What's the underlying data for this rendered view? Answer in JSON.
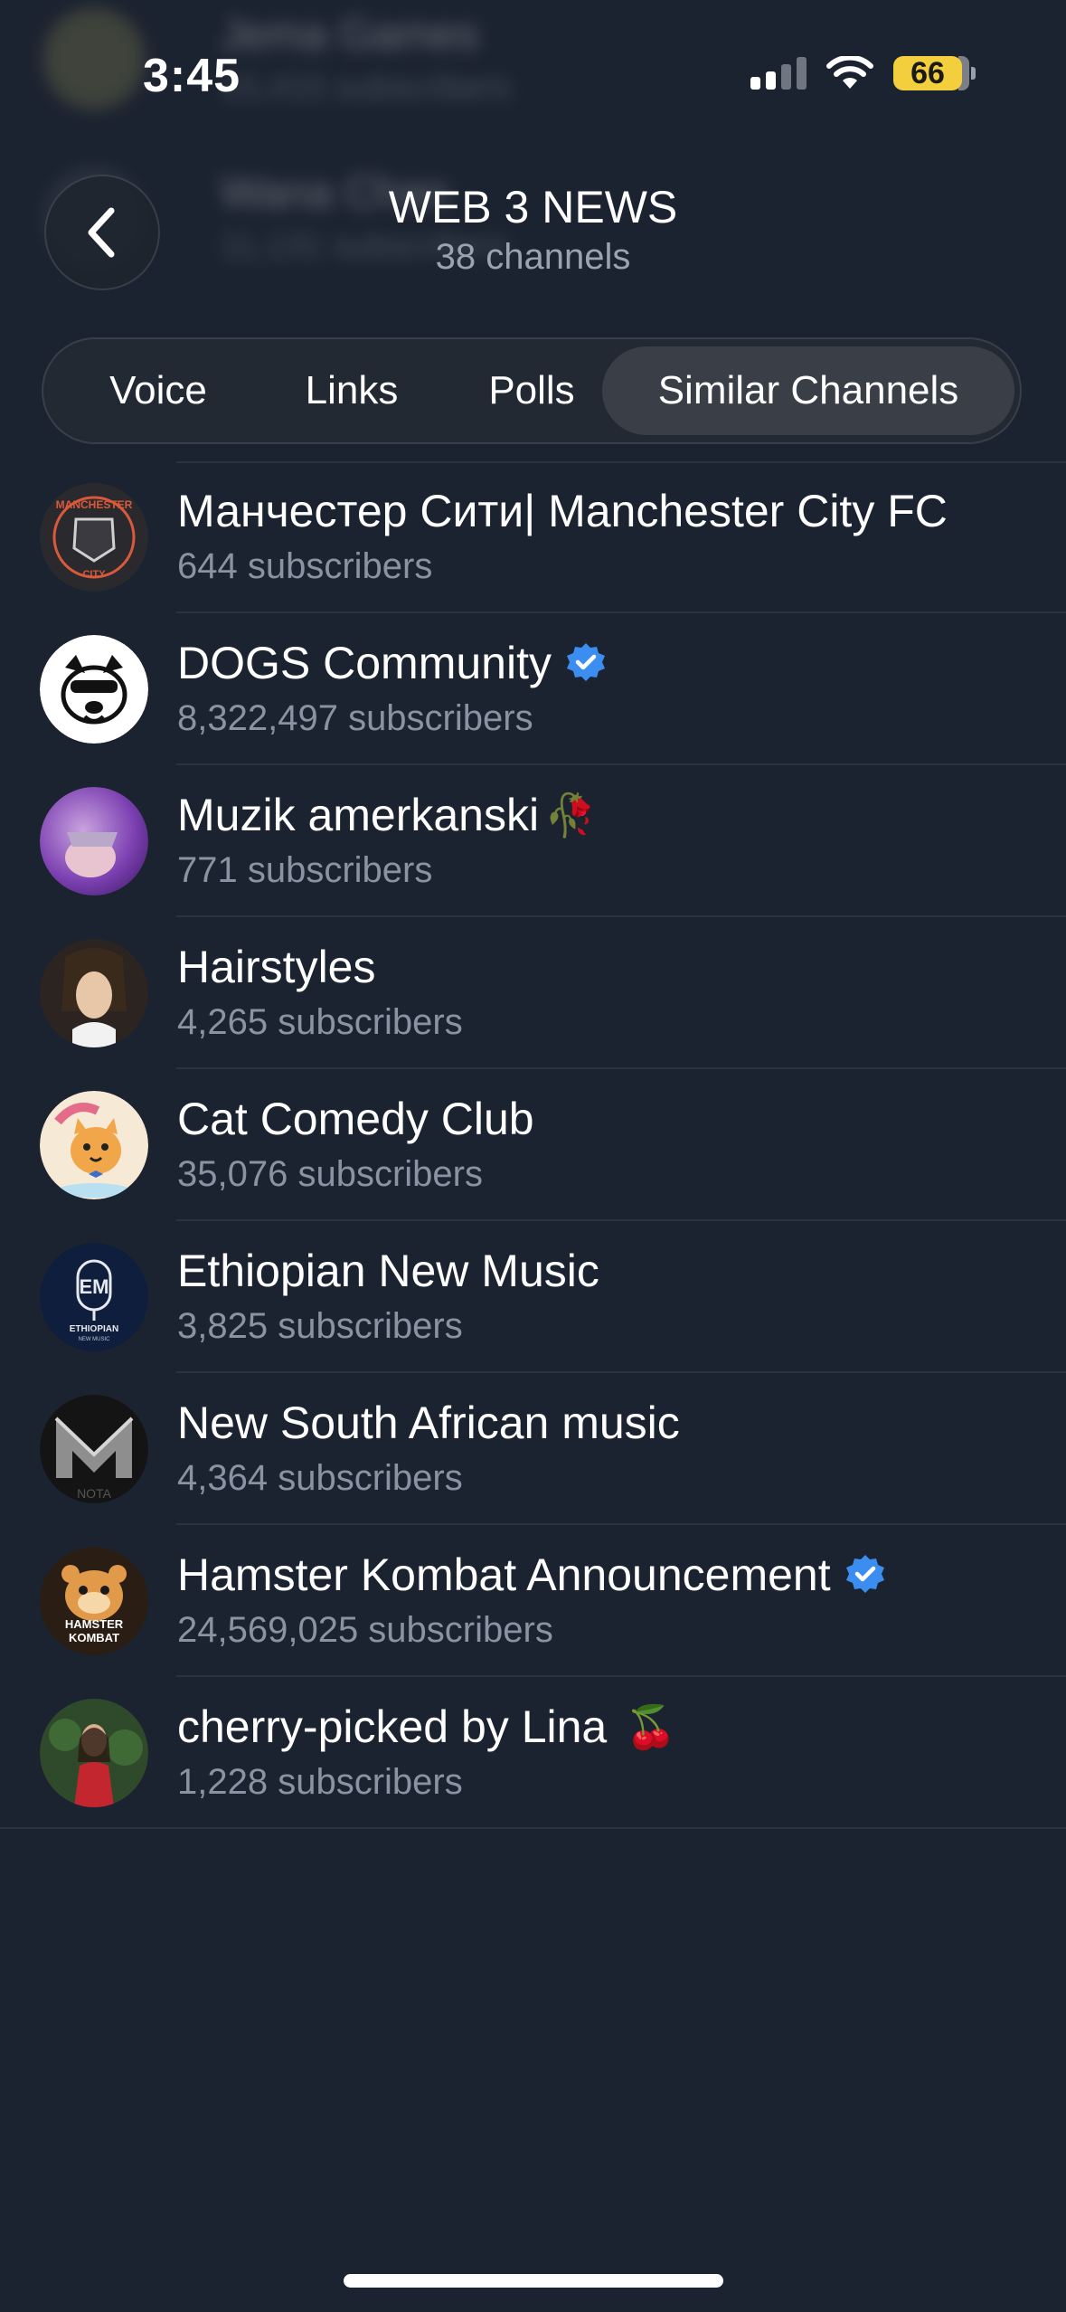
{
  "status_bar": {
    "time": "3:45",
    "battery": "66"
  },
  "background_list": [
    {
      "title": "Jema Games",
      "subtitle": "15,415 subscribers"
    },
    {
      "title": "Wana Chan",
      "subtitle": "11,131 subscribers"
    }
  ],
  "header": {
    "title": "WEB 3 NEWS",
    "subtitle": "38 channels"
  },
  "tabs": [
    {
      "label": "Voice",
      "active": false
    },
    {
      "label": "Links",
      "active": false
    },
    {
      "label": "Polls",
      "active": false
    },
    {
      "label": "Similar Channels",
      "active": true
    }
  ],
  "channels": [
    {
      "title": "Манчестер Сити| Manchester City FC",
      "subtitle": "644 subscribers",
      "verified": false,
      "emoji": "",
      "avatar_icon": "manchester-city-avatar"
    },
    {
      "title": "DOGS Community",
      "subtitle": "8,322,497 subscribers",
      "verified": true,
      "emoji": "",
      "avatar_icon": "dog-avatar"
    },
    {
      "title": "Muzik amerkanski",
      "subtitle": "771 subscribers",
      "verified": false,
      "emoji": "🥀",
      "avatar_icon": "purple-photo-avatar"
    },
    {
      "title": "Hairstyles",
      "subtitle": "4,265 subscribers",
      "verified": false,
      "emoji": "",
      "avatar_icon": "braids-photo-avatar"
    },
    {
      "title": "Cat Comedy Club",
      "subtitle": "35,076 subscribers",
      "verified": false,
      "emoji": "",
      "avatar_icon": "cartoon-cat-avatar"
    },
    {
      "title": "Ethiopian New Music",
      "subtitle": "3,825 subscribers",
      "verified": false,
      "emoji": "",
      "avatar_icon": "microphone-avatar"
    },
    {
      "title": "New South African music",
      "subtitle": "4,364 subscribers",
      "verified": false,
      "emoji": "",
      "avatar_icon": "m-logo-avatar"
    },
    {
      "title": "Hamster Kombat Announcement",
      "subtitle": "24,569,025 subscribers",
      "verified": true,
      "emoji": "",
      "avatar_icon": "hamster-avatar"
    },
    {
      "title": "cherry-picked by Lina",
      "subtitle": "1,228 subscribers",
      "verified": false,
      "emoji": "🍒",
      "avatar_icon": "portrait-photo-avatar"
    }
  ],
  "avatar_texts": {
    "manchester_city": "MANCHESTER",
    "manchester_city_bottom": "CITY",
    "ethiopian_letters": "EM",
    "ethiopian_label": "ETHIOPIAN",
    "ethiopian_sublabel": "NEW MUSIC",
    "sa_music_label": "NOTA",
    "hamster_line1": "HAMSTER",
    "hamster_line2": "KOMBAT"
  },
  "colors": {
    "background": "#1c2330",
    "active_tab": "#3a3f47",
    "verified_badge": "#3b8ef0",
    "secondary_text": "#8a93a1",
    "battery": "#f4cf3d"
  }
}
